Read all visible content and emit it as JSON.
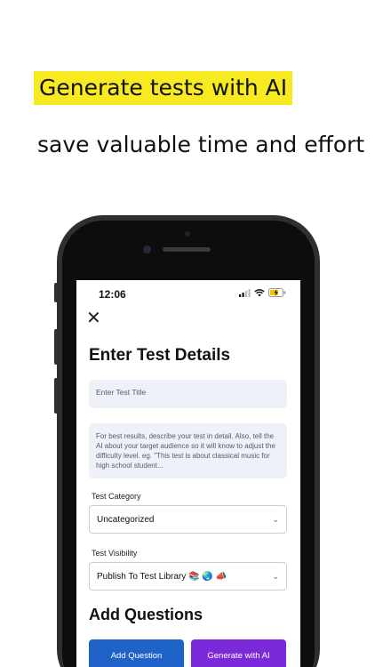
{
  "promo": {
    "headline": "Generate tests with AI",
    "subline": "save valuable time and effort"
  },
  "status_bar": {
    "time": "12:06"
  },
  "form": {
    "title": "Enter Test Details",
    "test_title_placeholder": "Enter Test Title",
    "description_placeholder": "For best results, describe your test in detail. Also, tell the AI about your target audience so it will know to adjust the difficulty level. eg. \"This test is about classical music for high school student...",
    "category_label": "Test Category",
    "category_value": "Uncategorized",
    "visibility_label": "Test Visibility",
    "visibility_value": "Publish To Test Library 📚 🌏 📣"
  },
  "questions": {
    "heading": "Add Questions",
    "add_label": "Add Question",
    "ai_label": "Generate with AI"
  },
  "colors": {
    "highlight": "#f7ea21",
    "add_button": "#1f62c8",
    "ai_button": "#7b2ad9"
  },
  "icons": [
    "close-icon",
    "chevron-down-icon",
    "signal-icon",
    "wifi-icon",
    "battery-icon"
  ]
}
